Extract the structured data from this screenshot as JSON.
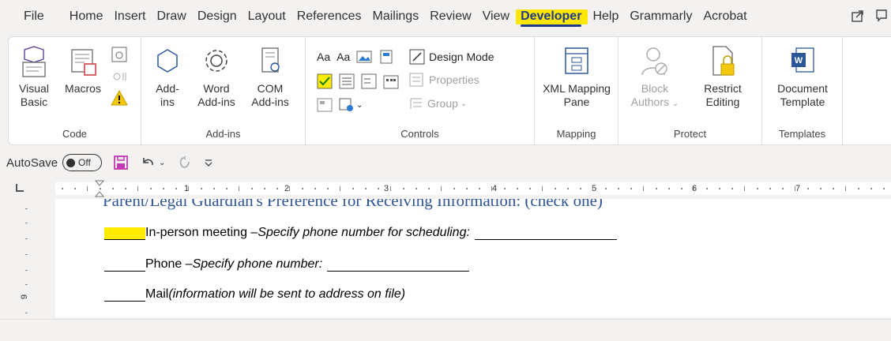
{
  "menu": {
    "tabs": [
      "File",
      "Home",
      "Insert",
      "Draw",
      "Design",
      "Layout",
      "References",
      "Mailings",
      "Review",
      "View",
      "Developer",
      "Help",
      "Grammarly",
      "Acrobat"
    ],
    "active": "Developer"
  },
  "ribbon": {
    "code": {
      "label": "Code",
      "visual_basic": [
        "Visual",
        "Basic"
      ],
      "macros": "Macros"
    },
    "addins": {
      "label": "Add-ins",
      "addins": [
        "Add-",
        "ins"
      ],
      "word_addins": [
        "Word",
        "Add-ins"
      ],
      "com_addins": [
        "COM",
        "Add-ins"
      ]
    },
    "controls": {
      "label": "Controls",
      "aa1": "Aa",
      "aa2": "Aa",
      "design_mode": "Design Mode",
      "properties": "Properties",
      "group": "Group"
    },
    "mapping": {
      "label": "Mapping",
      "xml_mapping": [
        "XML Mapping",
        "Pane"
      ]
    },
    "protect": {
      "label": "Protect",
      "block_authors": [
        "Block",
        "Authors"
      ],
      "restrict_editing": [
        "Restrict",
        "Editing"
      ]
    },
    "templates": {
      "label": "Templates",
      "document_template": [
        "Document",
        "Template"
      ]
    }
  },
  "qat": {
    "autosave": "AutoSave",
    "toggle": "Off"
  },
  "ruler": {
    "numbers": [
      "1",
      "2",
      "3",
      "4",
      "5",
      "6",
      "7"
    ],
    "vertical_number": "9"
  },
  "document": {
    "heading": "Parent/Legal Guardian's Preference for Receiving Information: (check one)",
    "lines": [
      {
        "label": "In-person meeting – ",
        "italic": "Specify phone number for scheduling:"
      },
      {
        "label": "Phone – ",
        "italic": "Specify phone number:"
      },
      {
        "label": "Mail ",
        "italic": "(information will be sent to address on file)"
      }
    ]
  },
  "colors": {
    "highlight": "#ffeb00",
    "developer_text": "#1e3a8a",
    "heading": "#2f5496"
  }
}
